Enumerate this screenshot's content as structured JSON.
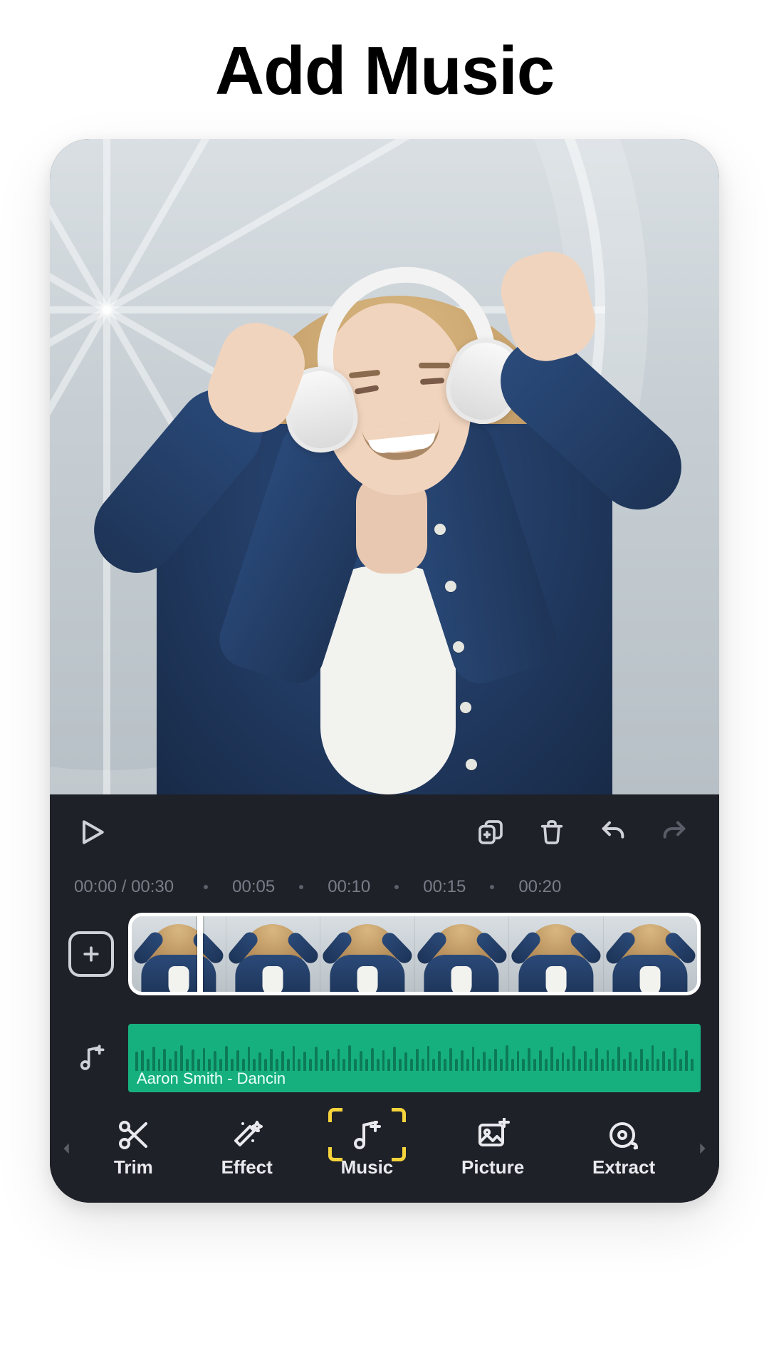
{
  "page": {
    "title": "Add Music"
  },
  "toolbar": {
    "icons": {
      "play": "play-icon",
      "copy": "copy-plus-icon",
      "delete": "trash-icon",
      "undo": "undo-icon",
      "redo": "redo-icon"
    }
  },
  "timeline": {
    "current": "00:00",
    "duration": "00:30",
    "now_dur": "00:00 / 00:30",
    "marks": [
      "00:05",
      "00:10",
      "00:15",
      "00:20"
    ]
  },
  "video_track": {
    "add_icon": "plus-icon",
    "thumbnails": 6
  },
  "audio_track": {
    "add_icon": "music-plus-icon",
    "title": "Aaron Smith - Dancin",
    "color": "#16b07f"
  },
  "bottom_nav": {
    "left_arrow": "chevron-left-icon",
    "right_arrow": "chevron-right-icon",
    "items": [
      {
        "id": "trim",
        "label": "Trim",
        "icon": "scissors-icon",
        "active": false
      },
      {
        "id": "effect",
        "label": "Effect",
        "icon": "wand-icon",
        "active": false
      },
      {
        "id": "music",
        "label": "Music",
        "icon": "music-plus-icon",
        "active": true
      },
      {
        "id": "picture",
        "label": "Picture",
        "icon": "image-plus-icon",
        "active": false
      },
      {
        "id": "extract",
        "label": "Extract",
        "icon": "disc-music-icon",
        "active": false
      }
    ]
  }
}
